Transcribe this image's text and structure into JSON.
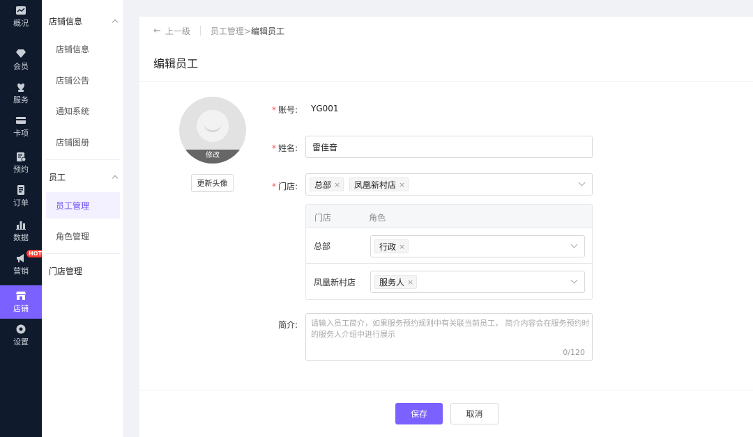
{
  "rail": {
    "items": [
      {
        "label": "概况",
        "icon": "chart-icon"
      },
      {
        "label": "会员",
        "icon": "diamond-icon"
      },
      {
        "label": "服务",
        "icon": "heart-hand-icon"
      },
      {
        "label": "卡项",
        "icon": "card-icon"
      },
      {
        "label": "预约",
        "icon": "calendar-icon"
      },
      {
        "label": "订单",
        "icon": "order-icon"
      },
      {
        "label": "数据",
        "icon": "bar-chart-icon"
      },
      {
        "label": "营销",
        "icon": "megaphone-icon",
        "badge": "HOT"
      },
      {
        "label": "店铺",
        "icon": "store-icon",
        "active": true
      },
      {
        "label": "设置",
        "icon": "gear-icon"
      }
    ],
    "active_color": "#7b61ff"
  },
  "subnav": {
    "groups": [
      {
        "title": "店铺信息",
        "items": [
          "店铺信息",
          "店铺公告",
          "通知系统",
          "店铺图册"
        ]
      },
      {
        "title": "员工",
        "items": [
          "员工管理",
          "角色管理"
        ]
      },
      {
        "title": "门店管理",
        "items": []
      }
    ],
    "active_item": "员工管理"
  },
  "breadcrumb": {
    "back": "上一级",
    "path": "员工管理> ",
    "current": "编辑员工"
  },
  "page_title": "编辑员工",
  "avatar": {
    "edit_label": "修改",
    "update_button": "更新头像"
  },
  "form": {
    "account": {
      "label": "账号:",
      "value": "YG001"
    },
    "name": {
      "label": "姓名:",
      "value": "雷佳音"
    },
    "store": {
      "label": "门店:",
      "tags": [
        "总部",
        "凤凰新村店"
      ]
    },
    "roles_table": {
      "headers": [
        "门店",
        "角色"
      ],
      "rows": [
        {
          "store": "总部",
          "role": "行政"
        },
        {
          "store": "凤凰新村店",
          "role": "服务人"
        }
      ]
    },
    "intro": {
      "label": "简介:",
      "placeholder": "请输入员工简介，如果服务预约规则中有关联当前员工， 简介内容会在服务预约时的服务人介绍中进行展示",
      "counter": "0/120"
    }
  },
  "actions": {
    "save": "保存",
    "cancel": "取消"
  },
  "colors": {
    "primary": "#7b61ff",
    "sidebar_bg": "#0f1b2d",
    "required": "#ff4d4f"
  }
}
